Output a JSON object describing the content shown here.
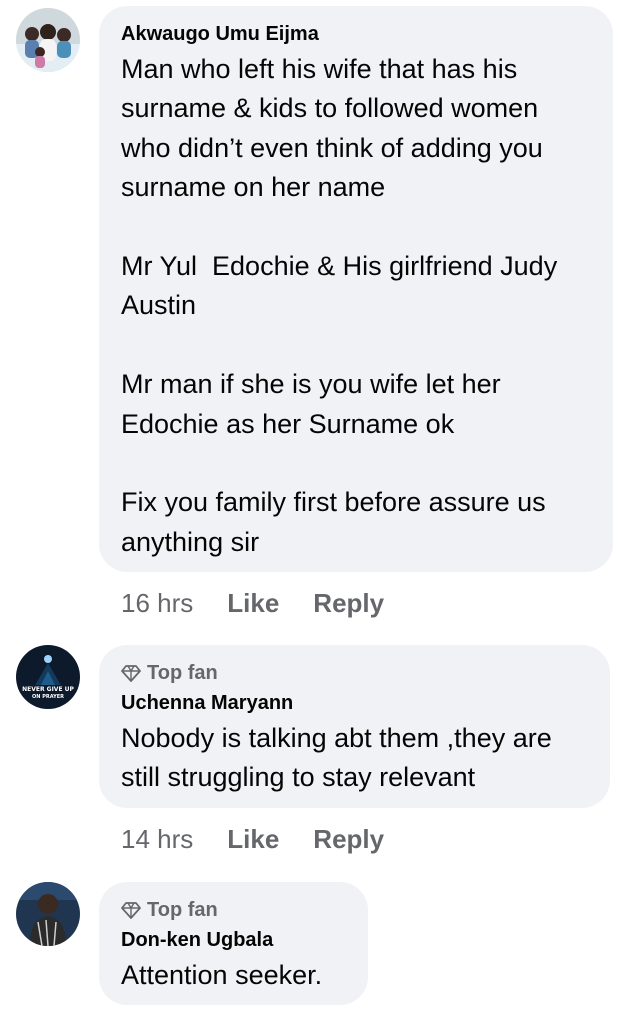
{
  "comments": [
    {
      "author": "Akwaugo Umu Eijma",
      "badge": "",
      "text": "Man who left his wife that has his surname & kids to followed women who didn’t even think of adding you surname on her name\n\nMr Yul  Edochie & His girlfriend Judy Austin\n\nMr man if she is you wife let her Edochie as her Surname ok\n\nFix you family first before assure us anything sir",
      "time": "16 hrs",
      "like_label": "Like",
      "reply_label": "Reply",
      "avatar_icon": "family-photo-avatar"
    },
    {
      "author": "Uchenna Maryann",
      "badge": "Top fan",
      "text": "Nobody is talking abt them ,they are still struggling to stay relevant",
      "time": "14 hrs",
      "like_label": "Like",
      "reply_label": "Reply",
      "avatar_icon": "never-give-up-avatar",
      "avatar_text_line1": "NEVER GIVE UP",
      "avatar_text_line2": "ON PRAYER"
    },
    {
      "author": "Don-ken Ugbala",
      "badge": "Top fan",
      "text": "Attention seeker.",
      "avatar_icon": "person-avatar"
    }
  ],
  "colors": {
    "bubble": "#f0f2f5",
    "meta": "#65676b",
    "text": "#050505"
  }
}
